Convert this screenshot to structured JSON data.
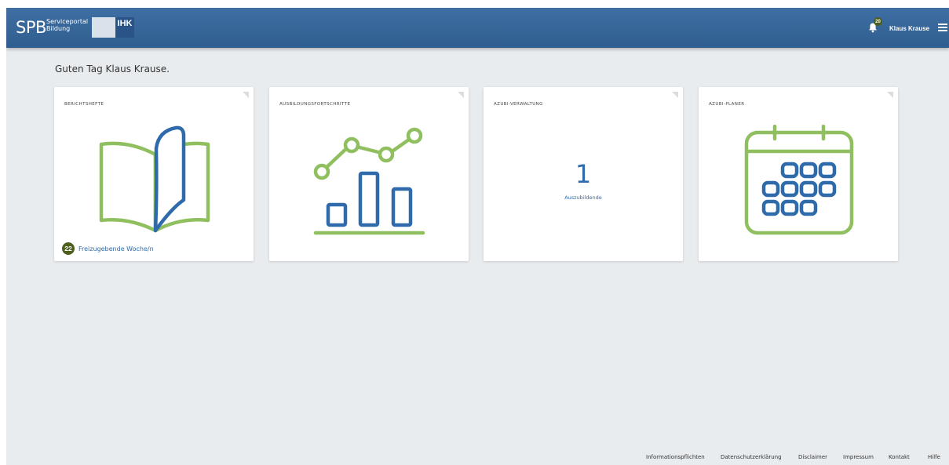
{
  "header": {
    "logo_main": "SPB",
    "logo_sub_1": "Serviceportal",
    "logo_sub_2": "Bildung",
    "logo_partner": "IHK",
    "notification_count": "20",
    "user_name": "Klaus Krause",
    "bell_icon": "bell-icon",
    "menu_icon": "hamburger-menu-icon"
  },
  "greeting": "Guten Tag Klaus Krause.",
  "cards": [
    {
      "title": "BERICHTSHEFTE",
      "icon": "open-book-icon",
      "badge_count": "22",
      "badge_label": "Freizugebende Woche/n"
    },
    {
      "title": "AUSBILDUNGSFORTSCHRITTE",
      "icon": "progress-chart-icon"
    },
    {
      "title": "AZUBI-VERWALTUNG",
      "number": "1",
      "number_label": "Auszubildende"
    },
    {
      "title": "AZUBI-PLANER",
      "icon": "calendar-icon"
    }
  ],
  "footer": {
    "links": [
      "Informationspflichten",
      "Datenschutzerklärung",
      "Disclaimer",
      "Impressum",
      "Kontakt",
      "Hilfe"
    ]
  },
  "colors": {
    "header_blue": "#2f5d8f",
    "accent_blue": "#2f6aaa",
    "accent_green": "#8fbf5f",
    "badge_olive": "#4d5f1f",
    "background": "#e9ecef"
  }
}
